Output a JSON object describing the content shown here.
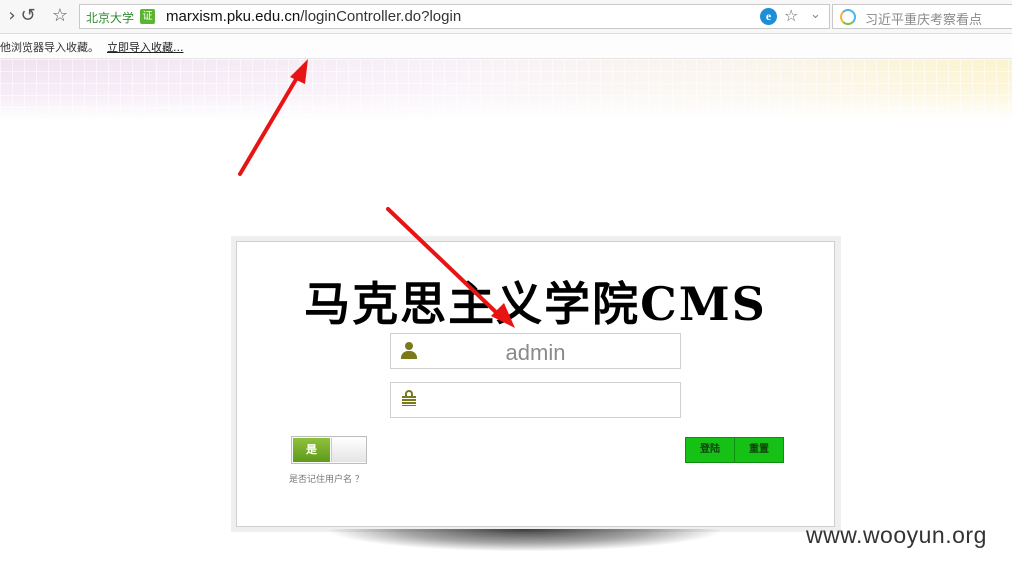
{
  "browser": {
    "site_name": "北京大学",
    "cert_badge": "证",
    "url_domain": "marxism.pku.edu.cn",
    "url_path": "/loginController.do?login",
    "ie_badge": "e",
    "search_placeholder": "习近平重庆考察看点"
  },
  "bookmarks": {
    "import_hint": "他浏览器导入收藏。",
    "import_link": "立即导入收藏..."
  },
  "login": {
    "title": "马克思主义学院CMS",
    "username_value": "admin",
    "password_value": "",
    "toggle_label": "是",
    "remember_label": "是否记住用户名 ？",
    "login_button": "登陆",
    "reset_button": "重置"
  },
  "watermark": "www.wooyun.org",
  "colors": {
    "button_green": "#16c116",
    "arrow_red": "#e81414",
    "icon_olive": "#7a7a1a",
    "toggle_green": "#6fa826"
  }
}
